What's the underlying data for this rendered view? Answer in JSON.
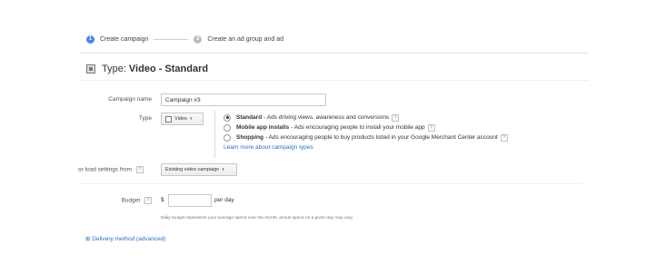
{
  "stepper": {
    "step1_num": "1",
    "step1_label": "Create campaign",
    "step2_num": "2",
    "step2_label": "Create an ad group and ad"
  },
  "section": {
    "title_prefix": "Type:",
    "title_value": "Video - Standard"
  },
  "campaign_name": {
    "label": "Campaign name",
    "value": "Campaign #3"
  },
  "type": {
    "label": "Type",
    "dropdown_label": "Video",
    "options": [
      {
        "bold": "Standard",
        "desc": " - Ads driving views, awareness and conversions",
        "selected": true
      },
      {
        "bold": "Mobile app installs",
        "desc": " - Ads encouraging people to install your mobile app",
        "selected": false
      },
      {
        "bold": "Shopping",
        "desc": " - Ads encouraging people to buy products listed in your Google Merchant Center account",
        "selected": false
      }
    ],
    "learn_more": "Learn more about campaign types"
  },
  "load_settings": {
    "label": "or load settings from",
    "button": "Existing video campaign"
  },
  "budget": {
    "label": "Budget",
    "currency": "$",
    "value": "",
    "suffix": "per day",
    "note": "Daily budget represents your average spend over the month, actual spend on a given day may vary."
  },
  "delivery": {
    "toggle": "⊞",
    "label": "Delivery method (advanced)"
  },
  "help_glyph": "?"
}
